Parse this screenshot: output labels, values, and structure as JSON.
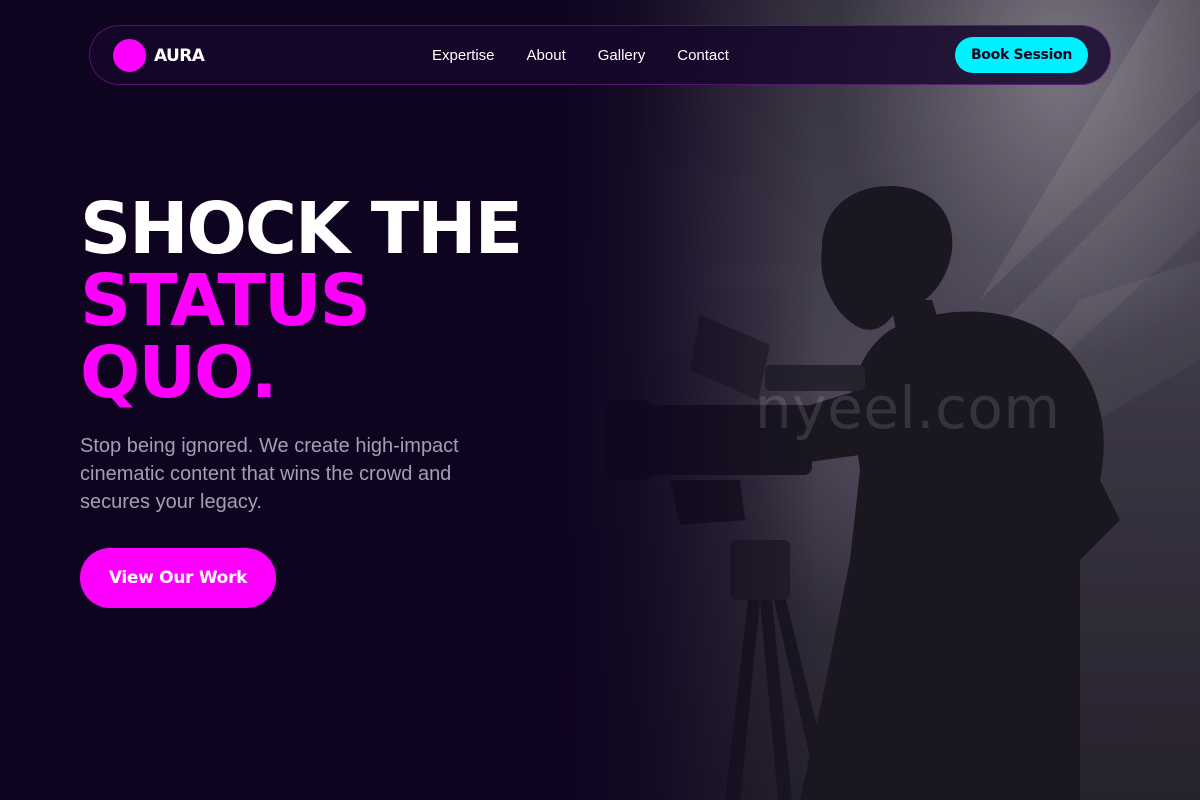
{
  "brand": {
    "name": "AURA",
    "accent": "#ff00ff",
    "secondary_accent": "#00f0ff",
    "background": "#0f0420"
  },
  "nav": {
    "links": [
      {
        "label": "Expertise"
      },
      {
        "label": "About"
      },
      {
        "label": "Gallery"
      },
      {
        "label": "Contact"
      }
    ],
    "cta_label": "Book Session"
  },
  "hero": {
    "headline_line1": "SHOCK THE",
    "headline_line2": "STATUS",
    "headline_line3": "QUO.",
    "subcopy": "Stop being ignored. We create high-impact cinematic content that wins the crowd and secures your legacy.",
    "cta_label": "View Our Work",
    "image_subject": "cameraman-with-tripod-camera-in-light-beams",
    "watermark": "nyeel.com"
  }
}
